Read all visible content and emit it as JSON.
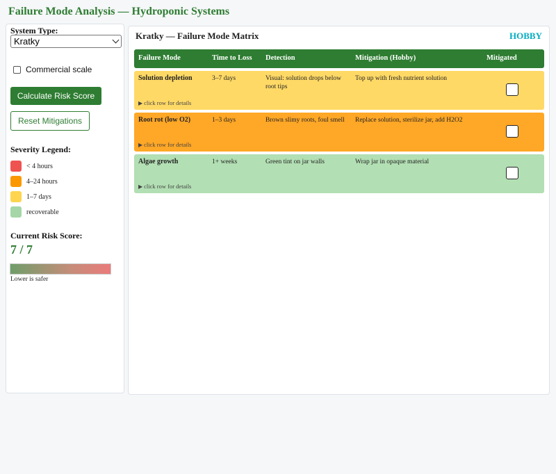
{
  "page": {
    "title": "Failure Mode Analysis — Hydroponic Systems"
  },
  "sidebar": {
    "system_type_label": "System Type:",
    "system_type_value": "Kratky",
    "commercial_label": "Commercial scale",
    "commercial_checked": false,
    "calculate_label": "Calculate Risk Score",
    "reset_label": "Reset Mitigations",
    "legend_title": "Severity Legend:",
    "legend": [
      {
        "label": "< 4 hours",
        "color": "#ef5350"
      },
      {
        "label": "4–24 hours",
        "color": "#fb9800"
      },
      {
        "label": "1–7 days",
        "color": "#ffd54f"
      },
      {
        "label": "recoverable",
        "color": "#a5d6a7"
      }
    ],
    "risk_title": "Current Risk Score:",
    "risk_value": "7 / 7",
    "risk_level": 1.0,
    "risk_caption": "Lower is safer"
  },
  "main": {
    "title": "Kratky — Failure Mode Matrix",
    "mode_badge": "HOBBY",
    "columns": [
      "Failure Mode",
      "Time to Loss",
      "Detection",
      "Mitigation (Hobby)",
      "Mitigated"
    ],
    "rows": [
      {
        "mode": "Solution depletion",
        "time": "3–7 days",
        "detection": "Visual: solution drops below root tips",
        "mitigation": "Top up with fresh nutrient solution",
        "mitigated": false,
        "hint": "click row for details",
        "color": "#ffd966"
      },
      {
        "mode": "Root rot (low O2)",
        "time": "1–3 days",
        "detection": "Brown slimy roots, foul smell",
        "mitigation": "Replace solution, sterilize jar, add H2O2",
        "mitigated": false,
        "hint": "click row for details",
        "color": "#ffa726"
      },
      {
        "mode": "Algae growth",
        "time": "1+ weeks",
        "detection": "Green tint on jar walls",
        "mitigation": "Wrap jar in opaque material",
        "mitigated": false,
        "hint": "click row for details",
        "color": "#b2dfb3"
      }
    ]
  },
  "colors": {
    "accent": "#2e7d32",
    "badge": "#00acc1"
  }
}
